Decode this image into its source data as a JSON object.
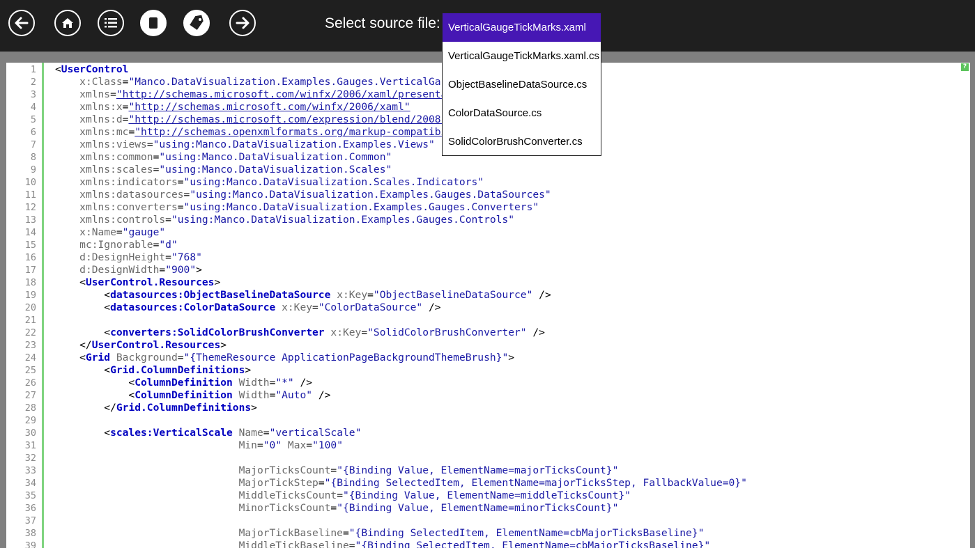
{
  "toolbar": {
    "buttons": [
      {
        "name": "back-button",
        "icon": "arrow-left-icon"
      },
      {
        "name": "home-button",
        "icon": "home-icon"
      },
      {
        "name": "list-button",
        "icon": "list-icon"
      },
      {
        "name": "stop-button",
        "icon": "stop-icon"
      },
      {
        "name": "tag-button",
        "icon": "tag-icon"
      },
      {
        "name": "forward-button",
        "icon": "arrow-right-icon"
      }
    ],
    "source_label": "Select source file:"
  },
  "file_dropdown": {
    "selected": "VerticalGaugeTickMarks.xaml",
    "options": [
      "VerticalGaugeTickMarks.xaml",
      "VerticalGaugeTickMarks.xaml.cs",
      "ObjectBaselineDataSource.cs",
      "ColorDataSource.cs",
      "SolidColorBrushConverter.cs"
    ]
  },
  "colors": {
    "toolbar_bg": "#1f1f1f",
    "dropdown_selected": "#4617b4",
    "gutter_accent": "#7fd47f",
    "tag": "#0000c0",
    "attr_value": "#1a1aa6"
  },
  "editor": {
    "lines": [
      [
        [
          "p",
          "<"
        ],
        [
          "t",
          "UserControl"
        ]
      ],
      [
        [
          "p",
          "    "
        ],
        [
          "a",
          "x:Class"
        ],
        [
          "p",
          "="
        ],
        [
          "v",
          "\"Manco.DataVisualization.Examples.Gauges.VerticalGaugeTickMarks\""
        ]
      ],
      [
        [
          "p",
          "    "
        ],
        [
          "a",
          "xmlns"
        ],
        [
          "p",
          "="
        ],
        [
          "u",
          "\"http://schemas.microsoft.com/winfx/2006/xaml/presentation\""
        ]
      ],
      [
        [
          "p",
          "    "
        ],
        [
          "a",
          "xmlns:x"
        ],
        [
          "p",
          "="
        ],
        [
          "u",
          "\"http://schemas.microsoft.com/winfx/2006/xaml\""
        ]
      ],
      [
        [
          "p",
          "    "
        ],
        [
          "a",
          "xmlns:d"
        ],
        [
          "p",
          "="
        ],
        [
          "u",
          "\"http://schemas.microsoft.com/expression/blend/2008\""
        ]
      ],
      [
        [
          "p",
          "    "
        ],
        [
          "a",
          "xmlns:mc"
        ],
        [
          "p",
          "="
        ],
        [
          "u",
          "\"http://schemas.openxmlformats.org/markup-compatibility/2006\""
        ]
      ],
      [
        [
          "p",
          "    "
        ],
        [
          "a",
          "xmlns:views"
        ],
        [
          "p",
          "="
        ],
        [
          "v",
          "\"using:Manco.DataVisualization.Examples.Views\""
        ]
      ],
      [
        [
          "p",
          "    "
        ],
        [
          "a",
          "xmlns:common"
        ],
        [
          "p",
          "="
        ],
        [
          "v",
          "\"using:Manco.DataVisualization.Common\""
        ]
      ],
      [
        [
          "p",
          "    "
        ],
        [
          "a",
          "xmlns:scales"
        ],
        [
          "p",
          "="
        ],
        [
          "v",
          "\"using:Manco.DataVisualization.Scales\""
        ]
      ],
      [
        [
          "p",
          "    "
        ],
        [
          "a",
          "xmlns:indicators"
        ],
        [
          "p",
          "="
        ],
        [
          "v",
          "\"using:Manco.DataVisualization.Scales.Indicators\""
        ]
      ],
      [
        [
          "p",
          "    "
        ],
        [
          "a",
          "xmlns:datasources"
        ],
        [
          "p",
          "="
        ],
        [
          "v",
          "\"using:Manco.DataVisualization.Examples.Gauges.DataSources\""
        ]
      ],
      [
        [
          "p",
          "    "
        ],
        [
          "a",
          "xmlns:converters"
        ],
        [
          "p",
          "="
        ],
        [
          "v",
          "\"using:Manco.DataVisualization.Examples.Gauges.Converters\""
        ]
      ],
      [
        [
          "p",
          "    "
        ],
        [
          "a",
          "xmlns:controls"
        ],
        [
          "p",
          "="
        ],
        [
          "v",
          "\"using:Manco.DataVisualization.Examples.Gauges.Controls\""
        ]
      ],
      [
        [
          "p",
          "    "
        ],
        [
          "a",
          "x:Name"
        ],
        [
          "p",
          "="
        ],
        [
          "v",
          "\"gauge\""
        ]
      ],
      [
        [
          "p",
          "    "
        ],
        [
          "a",
          "mc:Ignorable"
        ],
        [
          "p",
          "="
        ],
        [
          "v",
          "\"d\""
        ]
      ],
      [
        [
          "p",
          "    "
        ],
        [
          "a",
          "d:DesignHeight"
        ],
        [
          "p",
          "="
        ],
        [
          "v",
          "\"768\""
        ]
      ],
      [
        [
          "p",
          "    "
        ],
        [
          "a",
          "d:DesignWidth"
        ],
        [
          "p",
          "="
        ],
        [
          "v",
          "\"900\""
        ],
        [
          "p",
          ">"
        ]
      ],
      [
        [
          "p",
          "    <"
        ],
        [
          "t",
          "UserControl.Resources"
        ],
        [
          "p",
          ">"
        ]
      ],
      [
        [
          "p",
          "        <"
        ],
        [
          "t",
          "datasources:ObjectBaselineDataSource"
        ],
        [
          "p",
          " "
        ],
        [
          "a",
          "x:Key"
        ],
        [
          "p",
          "="
        ],
        [
          "v",
          "\"ObjectBaselineDataSource\""
        ],
        [
          "p",
          " />"
        ]
      ],
      [
        [
          "p",
          "        <"
        ],
        [
          "t",
          "datasources:ColorDataSource"
        ],
        [
          "p",
          " "
        ],
        [
          "a",
          "x:Key"
        ],
        [
          "p",
          "="
        ],
        [
          "v",
          "\"ColorDataSource\""
        ],
        [
          "p",
          " />"
        ]
      ],
      [],
      [
        [
          "p",
          "        <"
        ],
        [
          "t",
          "converters:SolidColorBrushConverter"
        ],
        [
          "p",
          " "
        ],
        [
          "a",
          "x:Key"
        ],
        [
          "p",
          "="
        ],
        [
          "v",
          "\"SolidColorBrushConverter\""
        ],
        [
          "p",
          " />"
        ]
      ],
      [
        [
          "p",
          "    </"
        ],
        [
          "t",
          "UserControl.Resources"
        ],
        [
          "p",
          ">"
        ]
      ],
      [
        [
          "p",
          "    <"
        ],
        [
          "t",
          "Grid"
        ],
        [
          "p",
          " "
        ],
        [
          "a",
          "Background"
        ],
        [
          "p",
          "="
        ],
        [
          "v",
          "\"{ThemeResource ApplicationPageBackgroundThemeBrush}\""
        ],
        [
          "p",
          ">"
        ]
      ],
      [
        [
          "p",
          "        <"
        ],
        [
          "t",
          "Grid.ColumnDefinitions"
        ],
        [
          "p",
          ">"
        ]
      ],
      [
        [
          "p",
          "            <"
        ],
        [
          "t",
          "ColumnDefinition"
        ],
        [
          "p",
          " "
        ],
        [
          "a",
          "Width"
        ],
        [
          "p",
          "="
        ],
        [
          "v",
          "\"*\""
        ],
        [
          "p",
          " />"
        ]
      ],
      [
        [
          "p",
          "            <"
        ],
        [
          "t",
          "ColumnDefinition"
        ],
        [
          "p",
          " "
        ],
        [
          "a",
          "Width"
        ],
        [
          "p",
          "="
        ],
        [
          "v",
          "\"Auto\""
        ],
        [
          "p",
          " />"
        ]
      ],
      [
        [
          "p",
          "        </"
        ],
        [
          "t",
          "Grid.ColumnDefinitions"
        ],
        [
          "p",
          ">"
        ]
      ],
      [],
      [
        [
          "p",
          "        <"
        ],
        [
          "t",
          "scales:VerticalScale"
        ],
        [
          "p",
          " "
        ],
        [
          "a",
          "Name"
        ],
        [
          "p",
          "="
        ],
        [
          "v",
          "\"verticalScale\""
        ]
      ],
      [
        [
          "p",
          "                              "
        ],
        [
          "a",
          "Min"
        ],
        [
          "p",
          "="
        ],
        [
          "v",
          "\"0\""
        ],
        [
          "p",
          " "
        ],
        [
          "a",
          "Max"
        ],
        [
          "p",
          "="
        ],
        [
          "v",
          "\"100\""
        ]
      ],
      [],
      [
        [
          "p",
          "                              "
        ],
        [
          "a",
          "MajorTicksCount"
        ],
        [
          "p",
          "="
        ],
        [
          "v",
          "\"{Binding Value, ElementName=majorTicksCount}\""
        ]
      ],
      [
        [
          "p",
          "                              "
        ],
        [
          "a",
          "MajorTickStep"
        ],
        [
          "p",
          "="
        ],
        [
          "v",
          "\"{Binding SelectedItem, ElementName=majorTicksStep, FallbackValue=0}\""
        ]
      ],
      [
        [
          "p",
          "                              "
        ],
        [
          "a",
          "MiddleTicksCount"
        ],
        [
          "p",
          "="
        ],
        [
          "v",
          "\"{Binding Value, ElementName=middleTicksCount}\""
        ]
      ],
      [
        [
          "p",
          "                              "
        ],
        [
          "a",
          "MinorTicksCount"
        ],
        [
          "p",
          "="
        ],
        [
          "v",
          "\"{Binding Value, ElementName=minorTicksCount}\""
        ]
      ],
      [],
      [
        [
          "p",
          "                              "
        ],
        [
          "a",
          "MajorTickBaseline"
        ],
        [
          "p",
          "="
        ],
        [
          "v",
          "\"{Binding SelectedItem, ElementName=cbMajorTicksBaseline}\""
        ]
      ],
      [
        [
          "p",
          "                              "
        ],
        [
          "a",
          "MiddleTickBaseline"
        ],
        [
          "p",
          "="
        ],
        [
          "v",
          "\"{Binding SelectedItem, ElementName=cbMajorTicksBaseline}\""
        ]
      ]
    ]
  }
}
